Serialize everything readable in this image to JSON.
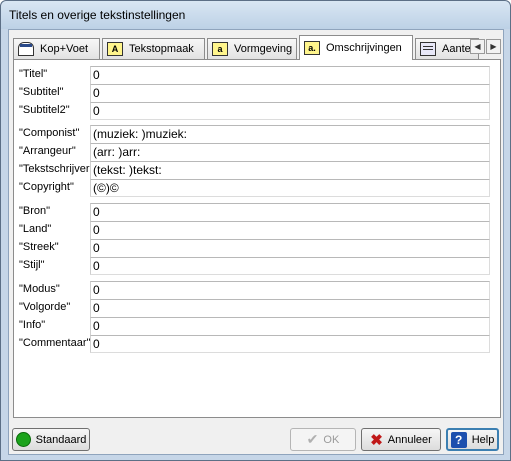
{
  "window": {
    "title": "Titels en overige tekstinstellingen"
  },
  "tabs": [
    {
      "label": "Kop+Voet",
      "icon": "page-header-icon"
    },
    {
      "label": "Tekstopmaak",
      "icon": "text-format-icon"
    },
    {
      "label": "Vormgeving",
      "icon": "layout-icon"
    },
    {
      "label": "Omschrijvingen",
      "icon": "description-icon",
      "active": true
    },
    {
      "label": "Aantek",
      "icon": "notes-icon"
    }
  ],
  "groups": [
    [
      {
        "label": "\"Titel\"",
        "value": "0"
      },
      {
        "label": "\"Subtitel\"",
        "value": "0"
      },
      {
        "label": "\"Subtitel2\"",
        "value": "0"
      }
    ],
    [
      {
        "label": "\"Componist\"",
        "value": "(muziek: )muziek:"
      },
      {
        "label": "\"Arrangeur\"",
        "value": "(arr: )arr:"
      },
      {
        "label": "\"Tekstschrijver\"",
        "value": "(tekst: )tekst:"
      },
      {
        "label": "\"Copyright\"",
        "value": "(©)©"
      }
    ],
    [
      {
        "label": "\"Bron\"",
        "value": "0"
      },
      {
        "label": "\"Land\"",
        "value": "0"
      },
      {
        "label": "\"Streek\"",
        "value": "0"
      },
      {
        "label": "\"Stijl\"",
        "value": "0"
      }
    ],
    [
      {
        "label": "\"Modus\"",
        "value": "0"
      },
      {
        "label": "\"Volgorde\"",
        "value": "0"
      },
      {
        "label": "\"Info\"",
        "value": "0"
      },
      {
        "label": "\"Commentaar\"",
        "value": "0"
      }
    ]
  ],
  "buttons": {
    "standaard": "Standaard",
    "ok": "OK",
    "annuleer": "Annuleer",
    "help": "Help"
  },
  "colors": {
    "help_icon": "#1c4fae",
    "cancel_icon": "#c01818",
    "standaard_dot": "#1ca31c"
  }
}
